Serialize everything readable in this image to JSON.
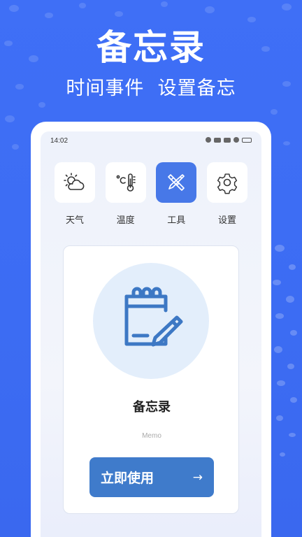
{
  "banner": {
    "title": "备忘录",
    "subtitle": "时间事件  设置备忘"
  },
  "status_bar": {
    "time": "14:02"
  },
  "tools": [
    {
      "label": "天气",
      "icon": "weather-icon",
      "active": false
    },
    {
      "label": "温度",
      "icon": "thermometer-icon",
      "active": false
    },
    {
      "label": "工具",
      "icon": "tools-icon",
      "active": true
    },
    {
      "label": "设置",
      "icon": "gear-icon",
      "active": false
    }
  ],
  "card": {
    "title": "备忘录",
    "subtitle": "Memo",
    "button_label": "立即使用",
    "button_arrow": "→"
  },
  "colors": {
    "background": "#3f6ff6",
    "accent": "#4778e8",
    "button": "#3f7bcb",
    "icon_stroke": "#3d78c4"
  }
}
